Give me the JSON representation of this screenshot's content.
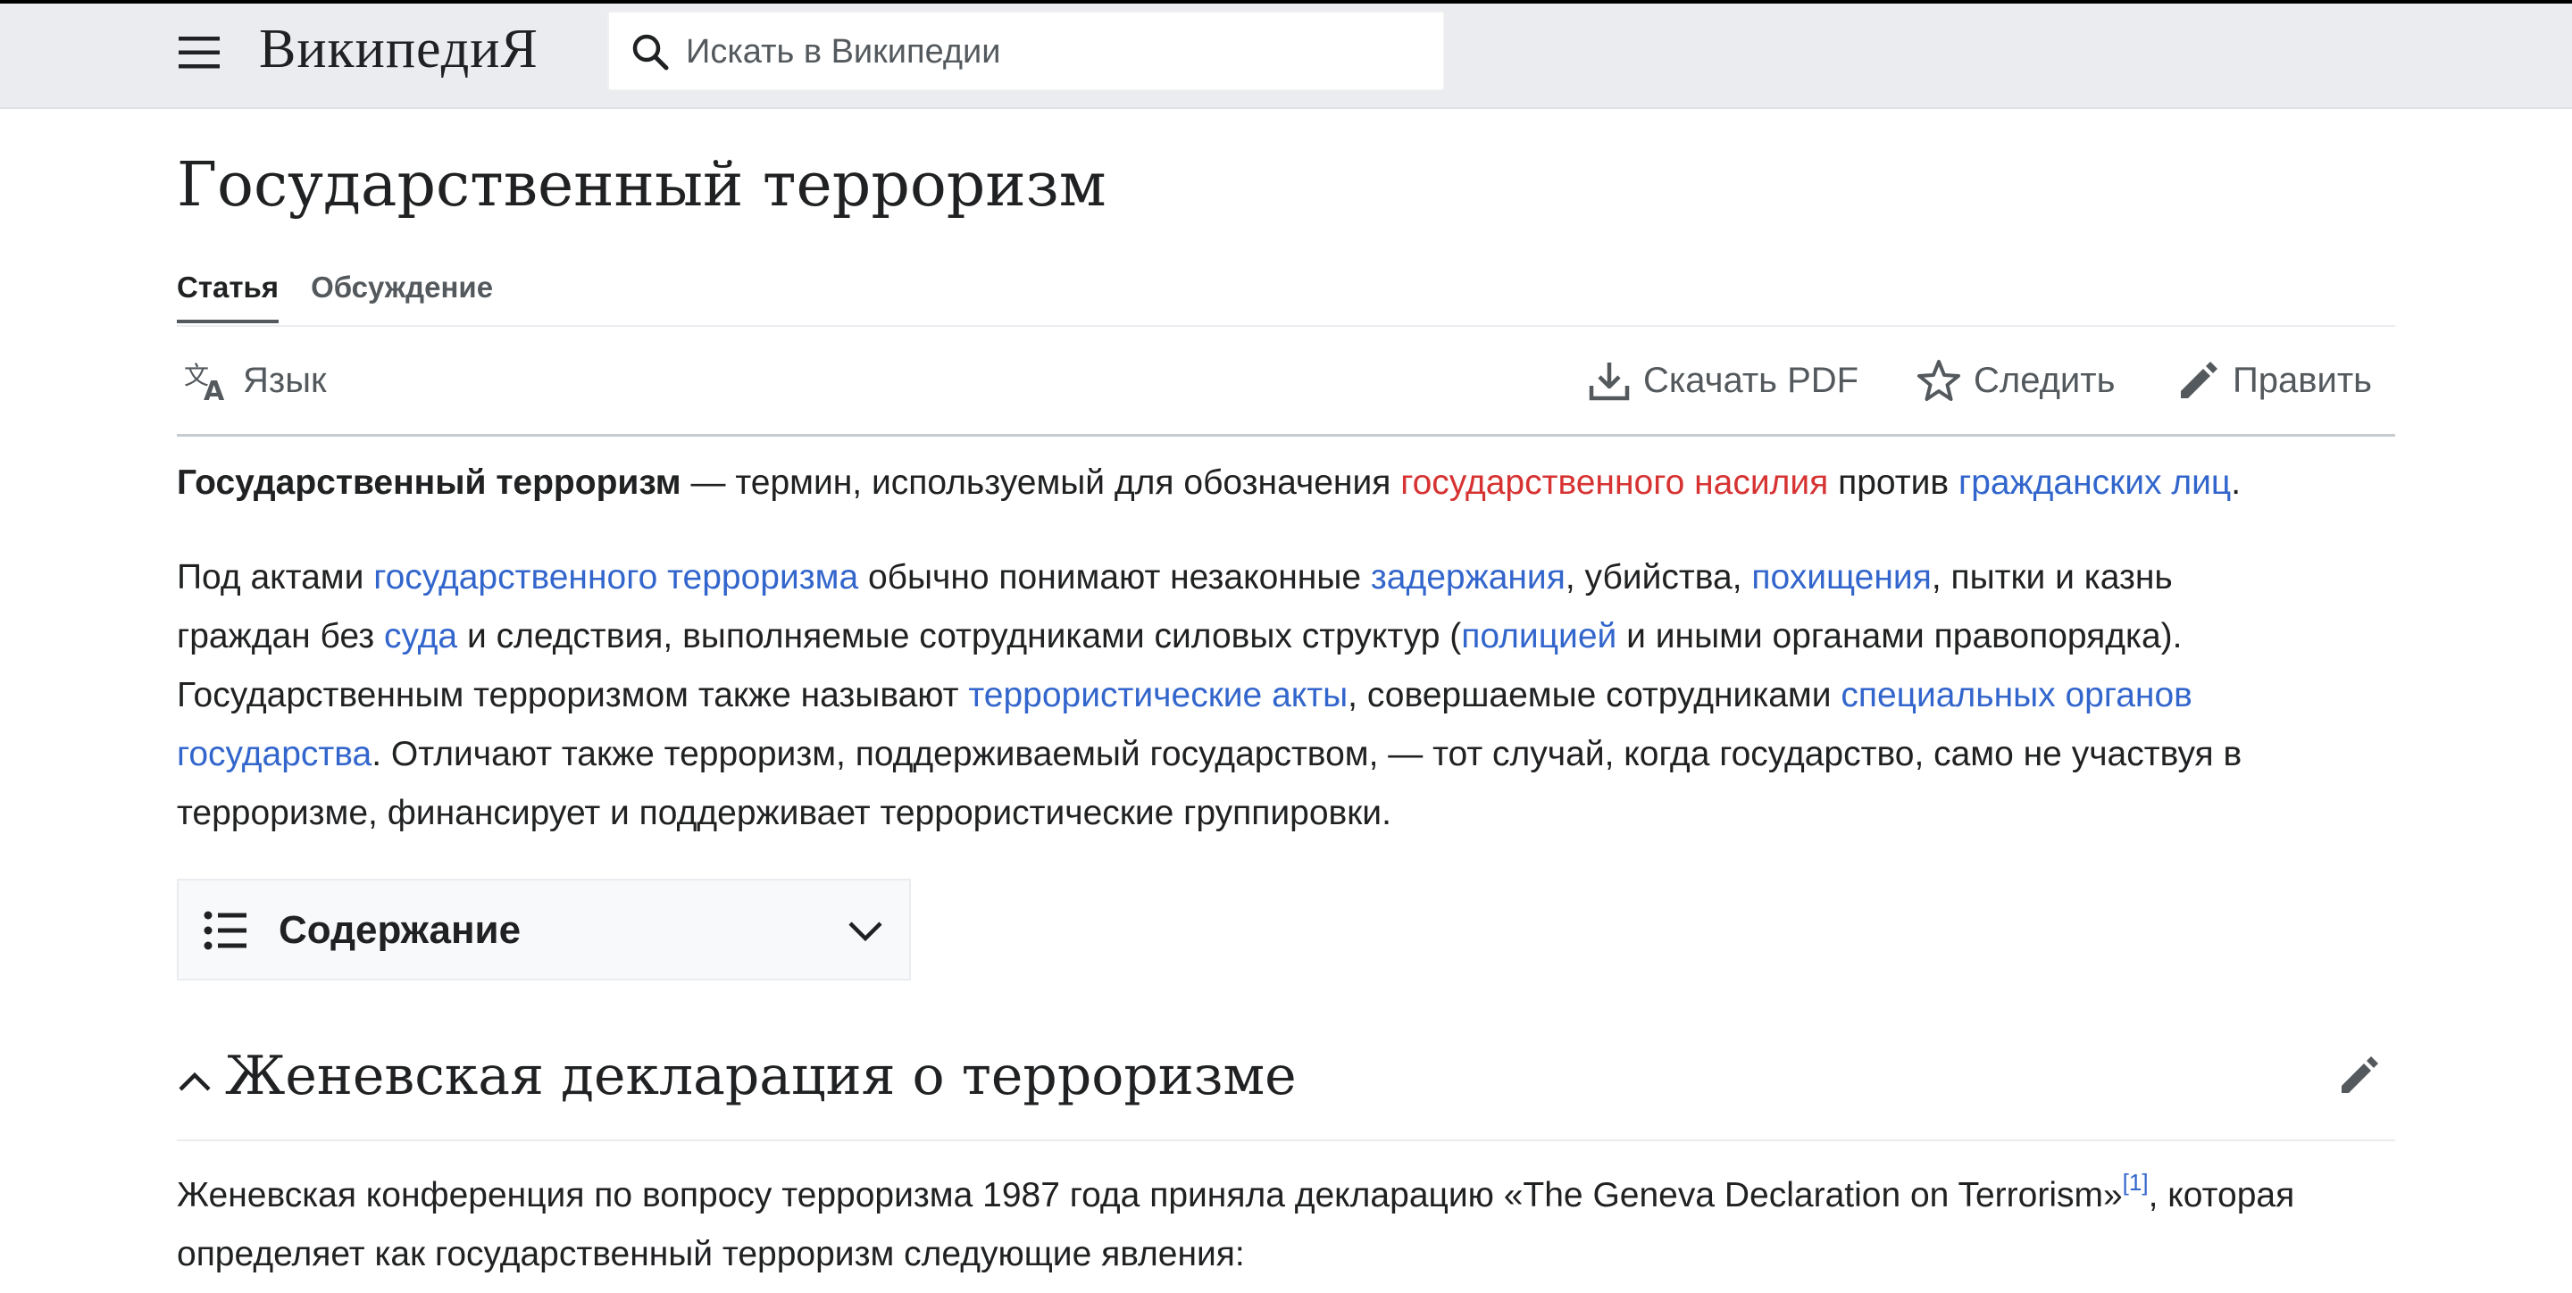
{
  "header": {
    "logo_text": "ВикипедиЯ",
    "search_placeholder": "Искать в Википедии"
  },
  "page": {
    "title": "Государственный терроризм"
  },
  "tabs": [
    {
      "label": "Статья",
      "active": true
    },
    {
      "label": "Обсуждение",
      "active": false
    }
  ],
  "toolbar": {
    "language_label": "Язык",
    "download_label": "Скачать PDF",
    "watch_label": "Следить",
    "edit_label": "Править"
  },
  "paragraph1": {
    "bold": "Государственный терроризм",
    "t1": " — термин, используемый для обозначения ",
    "link1": "государственного насилия",
    "t2": " против ",
    "link2": "гражданских лиц",
    "t3": "."
  },
  "paragraph2": {
    "l1_t1": "Под актами ",
    "l1_link1": "государственного терроризма",
    "l1_t2": " обычно понимают незаконные ",
    "l1_link2": "задержания",
    "l1_t3": ", убийства, ",
    "l1_link3": "похищения",
    "l1_t4": ", пытки и казнь",
    "l2_t1": "граждан без ",
    "l2_link1": "суда",
    "l2_t2": " и следствия, выполняемые сотрудниками силовых структур (",
    "l2_link2": "полицией",
    "l2_t3": " и иными органами правопорядка).",
    "l3_t1": "Государственным терроризмом также называют ",
    "l3_link1": "террористические акты",
    "l3_t2": ", совершаемые сотрудниками ",
    "l3_link2": "специальных органов",
    "l4_link1": "государства",
    "l4_t1": ". Отличают также терроризм, поддерживаемый государством, — тот случай, когда государство, само не участвуя в",
    "l5_t1": "терроризме, финансирует и поддерживает террористические группировки."
  },
  "toc": {
    "label": "Содержание"
  },
  "section1": {
    "title": "Женевская декларация о терроризме"
  },
  "paragraph3": {
    "l1_t1": "Женевская конференция по вопросу терроризма 1987 года приняла декларацию «The Geneva Declaration on Terrorism»",
    "l1_ref": "[1]",
    "l1_t2": ", которая",
    "l2_t1": "определяет как государственный терроризм следующие явления:"
  },
  "colors": {
    "link": "#3366cc",
    "redlink": "#d73333",
    "header_bg": "#eaecf0"
  }
}
